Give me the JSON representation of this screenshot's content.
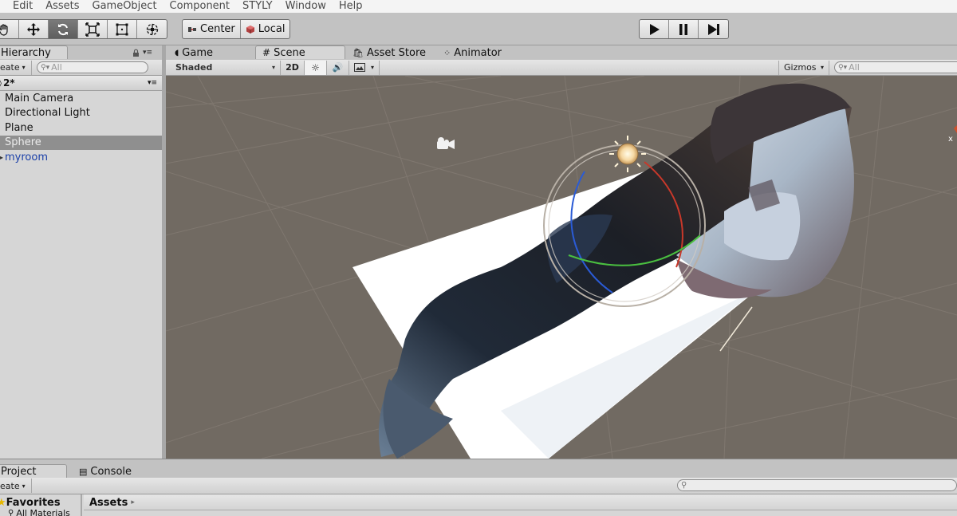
{
  "menu": [
    "",
    "Edit",
    "Assets",
    "GameObject",
    "Component",
    "STYLY",
    "Window",
    "Help"
  ],
  "toolbar": {
    "transform_tools": [
      "hand-tool",
      "move-tool",
      "rotate-tool",
      "scale-tool",
      "rect-tool",
      "transform-tool"
    ],
    "active_tool": "rotate-tool",
    "pivot_label": "Center",
    "space_label": "Local",
    "play_controls": [
      "play",
      "pause",
      "step"
    ]
  },
  "hierarchy": {
    "tab_label": "Hierarchy",
    "create_label": "eate",
    "search_placeholder": "All",
    "scene_name": "2*",
    "items": [
      {
        "label": "Main Camera",
        "selected": false,
        "prefab": false
      },
      {
        "label": "Directional Light",
        "selected": false,
        "prefab": false
      },
      {
        "label": "Plane",
        "selected": false,
        "prefab": false
      },
      {
        "label": "Sphere",
        "selected": true,
        "prefab": false
      },
      {
        "label": "myroom",
        "selected": false,
        "prefab": true
      }
    ]
  },
  "view_tabs": {
    "game": "Game",
    "scene": "Scene",
    "asset_store": "Asset Store",
    "animator": "Animator",
    "active": "Scene"
  },
  "scene_toolbar": {
    "shading_mode": "Shaded",
    "mode_2d": "2D",
    "gizmos_label": "Gizmos",
    "search_placeholder": "All"
  },
  "bottom": {
    "project_tab": "Project",
    "console_tab": "Console",
    "create_label": "eate",
    "favorites_label": "Favorites",
    "all_materials_label": "All Materials",
    "assets_label": "Assets"
  },
  "colors": {
    "scene_background": "#716a62",
    "panel_bg": "#d6d6d6",
    "selection": "#8f8f8f",
    "prefab_text": "#1a3fa8"
  }
}
